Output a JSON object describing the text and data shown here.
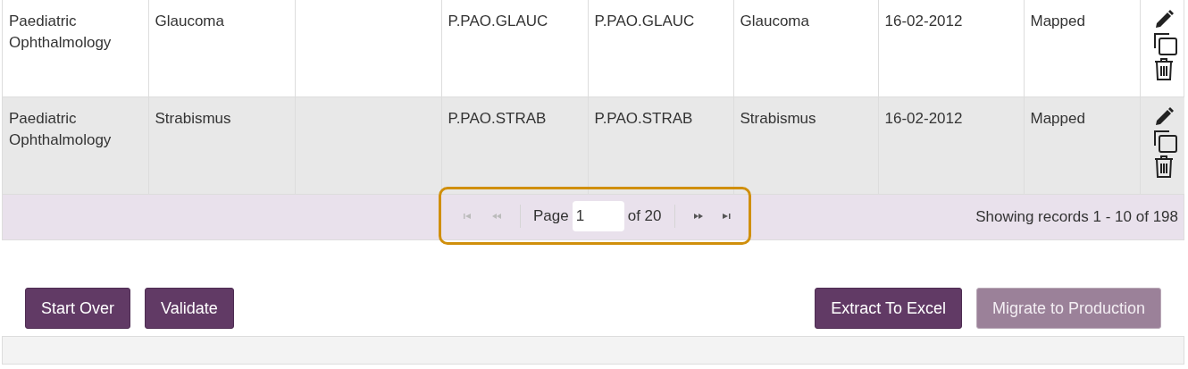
{
  "table": {
    "rows": [
      {
        "cells": [
          "Paediatric Ophthalmology",
          "Glaucoma",
          "",
          "P.PAO.GLAUC",
          "P.PAO.GLAUC",
          "Glaucoma",
          "16-02-2012",
          "Mapped"
        ]
      },
      {
        "cells": [
          "Paediatric Ophthalmology",
          "Strabismus",
          "",
          "P.PAO.STRAB",
          "P.PAO.STRAB",
          "Strabismus",
          "16-02-2012",
          "Mapped"
        ]
      }
    ]
  },
  "pager": {
    "highlighted": true,
    "buttons": [
      {
        "kind": "first",
        "disabled": true
      },
      {
        "kind": "prev",
        "disabled": true
      },
      {
        "kind": "next",
        "disabled": false
      },
      {
        "kind": "last",
        "disabled": false
      }
    ],
    "page_label": "Page",
    "page_value": "1",
    "of_label": "of 20",
    "records": "Showing records 1 - 10 of 198"
  },
  "actions_left": [
    {
      "label": "Start Over",
      "disabled": false
    },
    {
      "label": "Validate",
      "disabled": false
    }
  ],
  "actions_right": [
    {
      "label": "Extract To Excel",
      "disabled": false
    },
    {
      "label": "Migrate to Production",
      "disabled": true
    }
  ]
}
